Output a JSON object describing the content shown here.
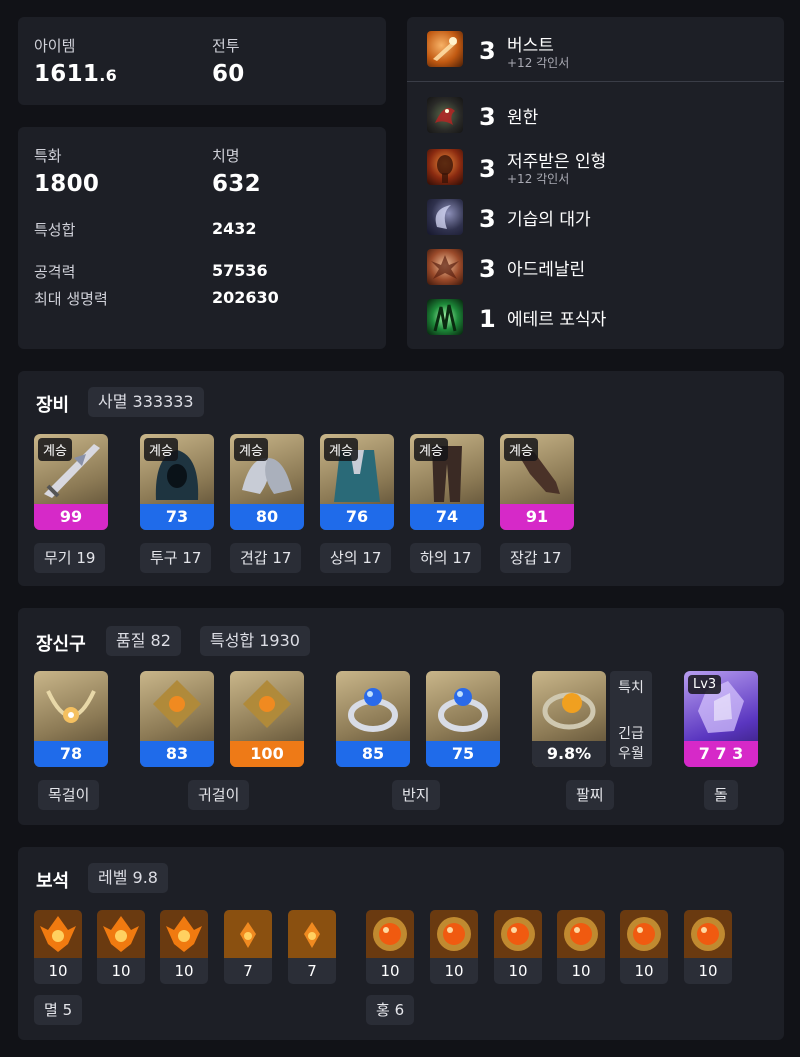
{
  "stats_top": {
    "item_label": "아이템",
    "item_value_main": "1611",
    "item_value_dec": ".6",
    "combat_label": "전투",
    "combat_value": "60"
  },
  "stats": {
    "spec_label": "특화",
    "spec_value": "1800",
    "crit_label": "치명",
    "crit_value": "632",
    "total_label": "특성합",
    "total_value": "2432",
    "atk_label": "공격력",
    "atk_value": "57536",
    "hp_label": "최대 생명력",
    "hp_value": "202630"
  },
  "engravings": [
    {
      "level": "3",
      "name": "버스트",
      "sub": "+12 각인서",
      "icon": "burst-icon"
    },
    {
      "level": "3",
      "name": "원한",
      "sub": "",
      "icon": "grudge-icon"
    },
    {
      "level": "3",
      "name": "저주받은 인형",
      "sub": "+12 각인서",
      "icon": "cursed-doll-icon"
    },
    {
      "level": "3",
      "name": "기습의 대가",
      "sub": "",
      "icon": "master-ambush-icon"
    },
    {
      "level": "3",
      "name": "아드레날린",
      "sub": "",
      "icon": "adrenaline-icon"
    },
    {
      "level": "1",
      "name": "에테르 포식자",
      "sub": "",
      "icon": "ether-predator-icon"
    }
  ],
  "equipment": {
    "title": "장비",
    "set_label": "사멸 333333",
    "items": [
      {
        "badge": "계승",
        "quality": "99",
        "label": "무기 19",
        "color": "#d629c8",
        "icon": "weapon-icon"
      },
      {
        "badge": "계승",
        "quality": "73",
        "label": "투구 17",
        "color": "#1f6bea",
        "icon": "helmet-icon"
      },
      {
        "badge": "계승",
        "quality": "80",
        "label": "견갑 17",
        "color": "#1f6bea",
        "icon": "shoulder-icon"
      },
      {
        "badge": "계승",
        "quality": "76",
        "label": "상의 17",
        "color": "#1f6bea",
        "icon": "chest-icon"
      },
      {
        "badge": "계승",
        "quality": "74",
        "label": "하의 17",
        "color": "#1f6bea",
        "icon": "pants-icon"
      },
      {
        "badge": "계승",
        "quality": "91",
        "label": "장갑 17",
        "color": "#d629c8",
        "icon": "gloves-icon"
      }
    ]
  },
  "accessories": {
    "title": "장신구",
    "quality_label": "품질 82",
    "stat_label": "특성합 1930",
    "items": [
      {
        "value": "78",
        "color": "#1f6bea",
        "icon": "necklace-icon"
      },
      {
        "value": "83",
        "color": "#1f6bea",
        "icon": "earring-icon"
      },
      {
        "value": "100",
        "color": "#ee7a17",
        "icon": "earring-icon"
      },
      {
        "value": "85",
        "color": "#1f6bea",
        "icon": "ring-icon"
      },
      {
        "value": "75",
        "color": "#1f6bea",
        "icon": "ring-icon"
      }
    ],
    "bracelet": {
      "value": "9.8%",
      "side_top": "특치",
      "side_b1": "긴급",
      "side_b2": "우월",
      "icon": "bracelet-icon"
    },
    "stone": {
      "badge": "Lv3",
      "value": "7 7 3",
      "color": "#d629c8",
      "icon": "ability-stone-icon"
    },
    "labels": {
      "necklace": "목걸이",
      "earring": "귀걸이",
      "ring": "반지",
      "bracelet": "팔찌",
      "stone": "돌"
    }
  },
  "gems": {
    "title": "보석",
    "level_label": "레벨 9.8",
    "left": [
      {
        "value": "10",
        "type": "flame"
      },
      {
        "value": "10",
        "type": "flame"
      },
      {
        "value": "10",
        "type": "flame"
      },
      {
        "value": "7",
        "type": "flame-small"
      },
      {
        "value": "7",
        "type": "flame-small"
      }
    ],
    "right": [
      {
        "value": "10",
        "type": "orb"
      },
      {
        "value": "10",
        "type": "orb"
      },
      {
        "value": "10",
        "type": "orb"
      },
      {
        "value": "10",
        "type": "orb"
      },
      {
        "value": "10",
        "type": "orb"
      },
      {
        "value": "10",
        "type": "orb"
      }
    ],
    "left_label": "멸 5",
    "right_label": "홍 6"
  }
}
